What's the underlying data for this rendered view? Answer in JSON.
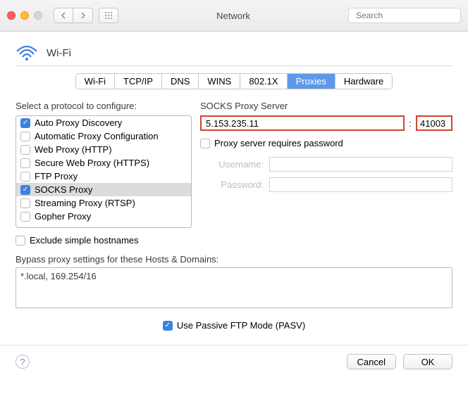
{
  "toolbar": {
    "title": "Network",
    "search_placeholder": "Search"
  },
  "header": {
    "title": "Wi-Fi"
  },
  "tabs": [
    "Wi-Fi",
    "TCP/IP",
    "DNS",
    "WINS",
    "802.1X",
    "Proxies",
    "Hardware"
  ],
  "active_tab": 5,
  "left": {
    "label": "Select a protocol to configure:",
    "protocols": [
      {
        "label": "Auto Proxy Discovery",
        "checked": true,
        "selected": false
      },
      {
        "label": "Automatic Proxy Configuration",
        "checked": false,
        "selected": false
      },
      {
        "label": "Web Proxy (HTTP)",
        "checked": false,
        "selected": false
      },
      {
        "label": "Secure Web Proxy (HTTPS)",
        "checked": false,
        "selected": false
      },
      {
        "label": "FTP Proxy",
        "checked": false,
        "selected": false
      },
      {
        "label": "SOCKS Proxy",
        "checked": true,
        "selected": true
      },
      {
        "label": "Streaming Proxy (RTSP)",
        "checked": false,
        "selected": false
      },
      {
        "label": "Gopher Proxy",
        "checked": false,
        "selected": false
      }
    ]
  },
  "right": {
    "label": "SOCKS Proxy Server",
    "ip": "5.153.235.11",
    "port": "41003",
    "requires_password_label": "Proxy server requires password",
    "requires_password": false,
    "username_label": "Username:",
    "password_label": "Password:",
    "username": "",
    "password": ""
  },
  "exclude": {
    "label": "Exclude simple hostnames",
    "checked": false
  },
  "bypass": {
    "label": "Bypass proxy settings for these Hosts & Domains:",
    "value": "*.local, 169.254/16"
  },
  "pasv": {
    "label": "Use Passive FTP Mode (PASV)",
    "checked": true
  },
  "footer": {
    "cancel": "Cancel",
    "ok": "OK"
  }
}
